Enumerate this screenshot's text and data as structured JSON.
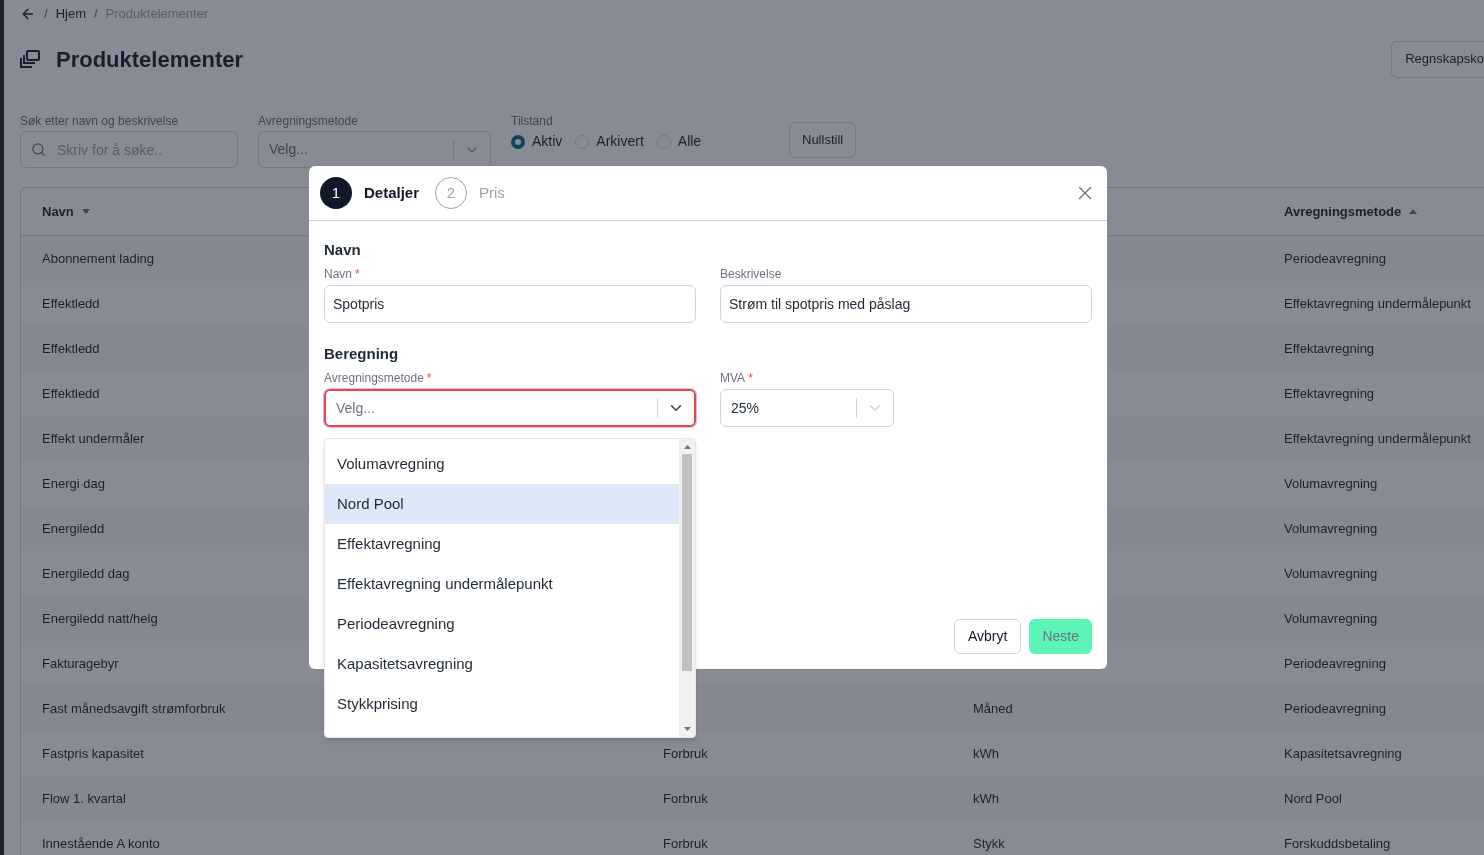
{
  "breadcrumb": {
    "items": [
      {
        "separator": "/",
        "label": "Hjem",
        "current": false
      },
      {
        "separator": "/",
        "label": "Produktelementer",
        "current": true
      }
    ]
  },
  "page_title": "Produktelementer",
  "header_button": "Regnskapsko",
  "filters": {
    "search": {
      "label": "Søk etter navn og beskrivelse",
      "placeholder": "Skriv for å søke.."
    },
    "method": {
      "label": "Avregningsmetode",
      "placeholder": "Velg..."
    },
    "state": {
      "label": "Tilstand",
      "options": [
        {
          "label": "Aktiv",
          "selected": true
        },
        {
          "label": "Arkivert",
          "selected": false
        },
        {
          "label": "Alle",
          "selected": false
        }
      ]
    },
    "reset_button": "Nullstill"
  },
  "table": {
    "columns": [
      {
        "label": "Navn",
        "sort_ascending": false
      },
      {
        "label": "Avregningsmetode",
        "sort_ascending": true
      }
    ],
    "rows": [
      {
        "navn": "Abonnement lading",
        "avregningsmetode": "Periodeavregning"
      },
      {
        "navn": "Effektledd",
        "avregningsmetode": "Effektavregning undermålepunkt"
      },
      {
        "navn": "Effektledd",
        "avregningsmetode": "Effektavregning"
      },
      {
        "navn": "Effektledd",
        "avregningsmetode": "Effektavregning"
      },
      {
        "navn": "Effekt undermåler",
        "avregningsmetode": "Effektavregning undermålepunkt"
      },
      {
        "navn": "Energi dag",
        "avregningsmetode": "Volumavregning"
      },
      {
        "navn": "Energiledd",
        "avregningsmetode": "Volumavregning"
      },
      {
        "navn": "Energiledd dag",
        "avregningsmetode": "Volumavregning"
      },
      {
        "navn": "Energiledd natt/helg",
        "avregningsmetode": "Volumavregning"
      },
      {
        "navn": "Fakturagebyr",
        "avregningsmetode": "Periodeavregning"
      },
      {
        "navn": "Fast månedsavgift strømforbruk",
        "column_3": "Måned",
        "avregningsmetode": "Periodeavregning"
      },
      {
        "navn": "Fastpris kapasitet",
        "column_2": "Forbruk",
        "column_3": "kWh",
        "avregningsmetode": "Kapasitetsavregning"
      },
      {
        "navn": "Flow 1. kvartal",
        "column_2": "Forbruk",
        "column_3": "kWh",
        "avregningsmetode": "Nord Pool"
      },
      {
        "navn": "Innestående A konto",
        "column_2": "Forbruk",
        "column_3": "Stykk",
        "avregningsmetode": "Forskuddsbetaling"
      }
    ]
  },
  "dialog": {
    "steps": [
      {
        "number": "1",
        "label": "Detaljer",
        "selected": true
      },
      {
        "number": "2",
        "label": "Pris",
        "selected": false
      }
    ],
    "sections": [
      {
        "title": "Navn",
        "fields": [
          {
            "kind": "text",
            "label": "Navn",
            "required_mark": "*",
            "value": "Spotpris"
          },
          {
            "kind": "text",
            "label": "Beskrivelse",
            "value": "Strøm til spotpris med påslag"
          }
        ]
      },
      {
        "title": "Beregning",
        "fields": [
          {
            "kind": "select",
            "label": "Avregningsmetode",
            "required_mark": "*",
            "placeholder": "Velg...",
            "error": true
          },
          {
            "kind": "select",
            "label": "MVA",
            "required_mark": "*",
            "value": "25%",
            "error": false
          }
        ]
      }
    ],
    "dropdown": {
      "options": [
        {
          "label": "Volumavregning",
          "selected": false
        },
        {
          "label": "Nord Pool",
          "selected": true
        },
        {
          "label": "Effektavregning",
          "selected": false
        },
        {
          "label": "Effektavregning undermålepunkt",
          "selected": false
        },
        {
          "label": "Periodeavregning",
          "selected": false
        },
        {
          "label": "Kapasitetsavregning",
          "selected": false
        },
        {
          "label": "Stykkprising",
          "selected": false
        }
      ]
    },
    "buttons": [
      {
        "label": "Avbryt",
        "kind": "secondary",
        "disabled": false
      },
      {
        "label": "Neste",
        "kind": "primary",
        "disabled": true
      }
    ]
  }
}
